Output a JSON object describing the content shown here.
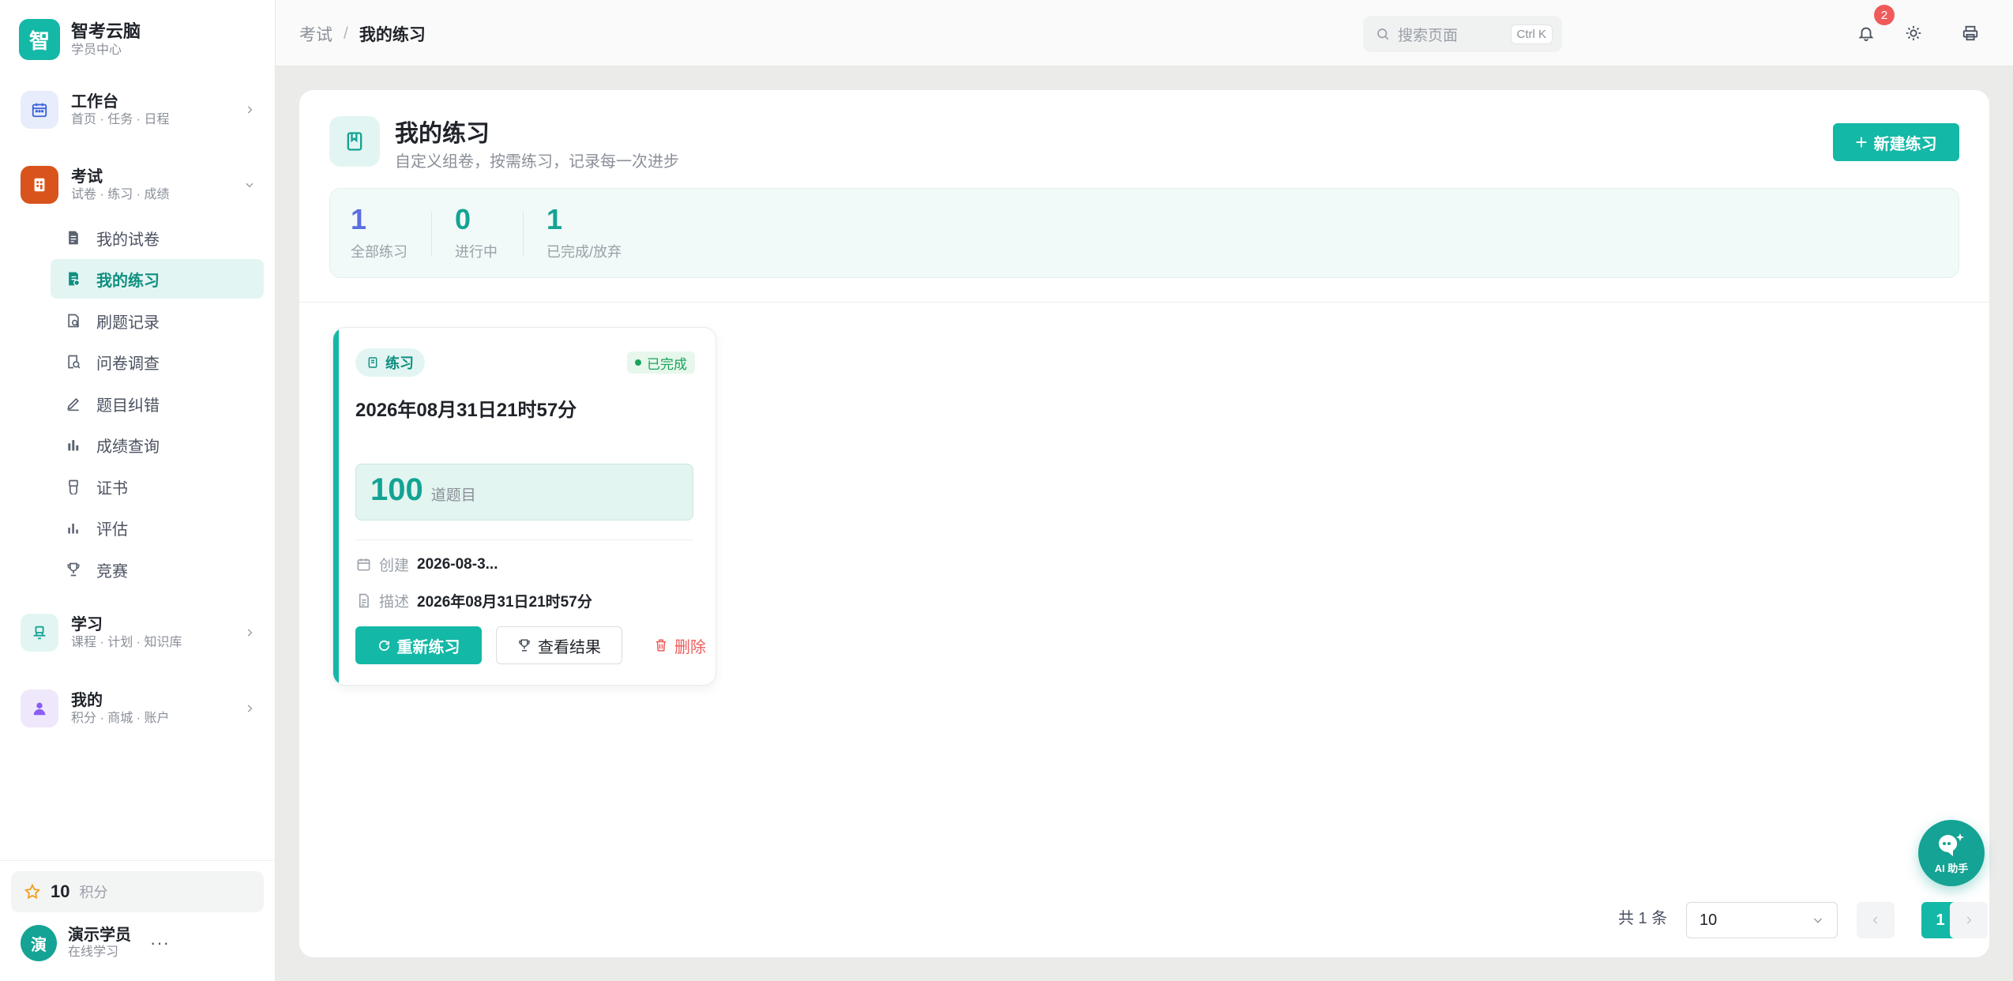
{
  "colors": {
    "accent": "#14b8a6",
    "accent_dark": "#0f8f81",
    "danger": "#ee5b5b",
    "success": "#1aa35b"
  },
  "brand": {
    "logo_char": "智",
    "title": "智考云脑",
    "subtitle": "学员中心"
  },
  "sidebar": {
    "groups": [
      {
        "title": "工作台",
        "subtitle": "首页 · 任务 · 日程",
        "icon": "calendar-icon",
        "expanded": false
      },
      {
        "title": "考试",
        "subtitle": "试卷 · 练习 · 成绩",
        "icon": "exam-icon",
        "expanded": true
      },
      {
        "title": "学习",
        "subtitle": "课程 · 计划 · 知识库",
        "icon": "learning-icon",
        "expanded": false
      },
      {
        "title": "我的",
        "subtitle": "积分 · 商城 · 账户",
        "icon": "user-icon",
        "expanded": false
      }
    ],
    "exam_items": [
      {
        "label": "我的试卷",
        "icon": "paper-icon"
      },
      {
        "label": "我的练习",
        "icon": "practice-icon",
        "active": true
      },
      {
        "label": "刷题记录",
        "icon": "record-icon"
      },
      {
        "label": "问卷调查",
        "icon": "survey-icon"
      },
      {
        "label": "题目纠错",
        "icon": "edit-icon"
      },
      {
        "label": "成绩查询",
        "icon": "bar-chart-icon"
      },
      {
        "label": "证书",
        "icon": "certificate-icon"
      },
      {
        "label": "评估",
        "icon": "assessment-icon"
      },
      {
        "label": "竞赛",
        "icon": "trophy-icon"
      }
    ],
    "points": {
      "value": "10",
      "label": "积分"
    },
    "user": {
      "avatar_char": "演",
      "name": "演示学员",
      "status": "在线学习",
      "more": "···"
    }
  },
  "topbar": {
    "breadcrumb": {
      "parent": "考试",
      "separator": "/",
      "current": "我的练习"
    },
    "search": {
      "placeholder": "搜索页面",
      "shortcut": "Ctrl K"
    },
    "notifications": {
      "count": "2"
    }
  },
  "page": {
    "title": "我的练习",
    "description": "自定义组卷，按需练习，记录每一次进步",
    "new_button": "新建练习",
    "stats": [
      {
        "value": "1",
        "label": "全部练习",
        "color": "#5b6ee1"
      },
      {
        "value": "0",
        "label": "进行中",
        "color": "#14a394"
      },
      {
        "value": "1",
        "label": "已完成/放弃",
        "color": "#14a394"
      }
    ]
  },
  "cards": [
    {
      "tag": "练习",
      "status": "已完成",
      "title": "2026年08月31日21时57分",
      "question_count": "100",
      "question_unit": "道题目",
      "created_label": "创建",
      "created_value": "2026-08-3...",
      "desc_label": "描述",
      "desc_value": "2026年08月31日21时57分",
      "actions": {
        "redo": "重新练习",
        "result": "查看结果",
        "delete": "删除"
      }
    }
  ],
  "pagination": {
    "total": "共 1 条",
    "page_size": "10",
    "current_page": "1"
  },
  "ai_assistant": {
    "label": "AI 助手"
  }
}
